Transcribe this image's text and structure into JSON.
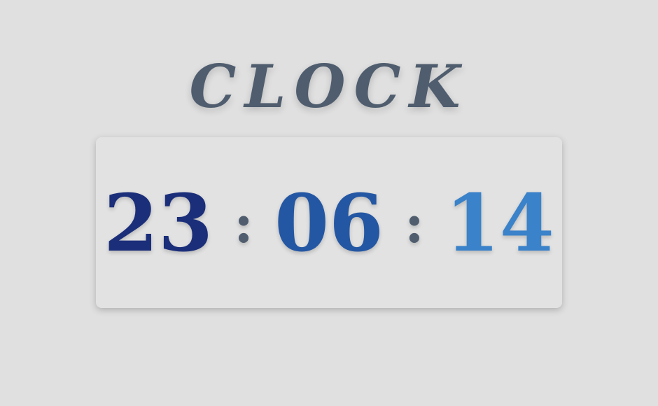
{
  "title": "CLOCK",
  "clock": {
    "hours": "23",
    "minutes": "06",
    "seconds": "14",
    "separator_1": ":",
    "separator_2": ":"
  },
  "colors": {
    "background": "#e0e0e0",
    "title": "#4f5d6e",
    "hours": "#1b2e7a",
    "minutes": "#2457a3",
    "seconds": "#3a82c9",
    "separator": "#4f5d6e"
  }
}
